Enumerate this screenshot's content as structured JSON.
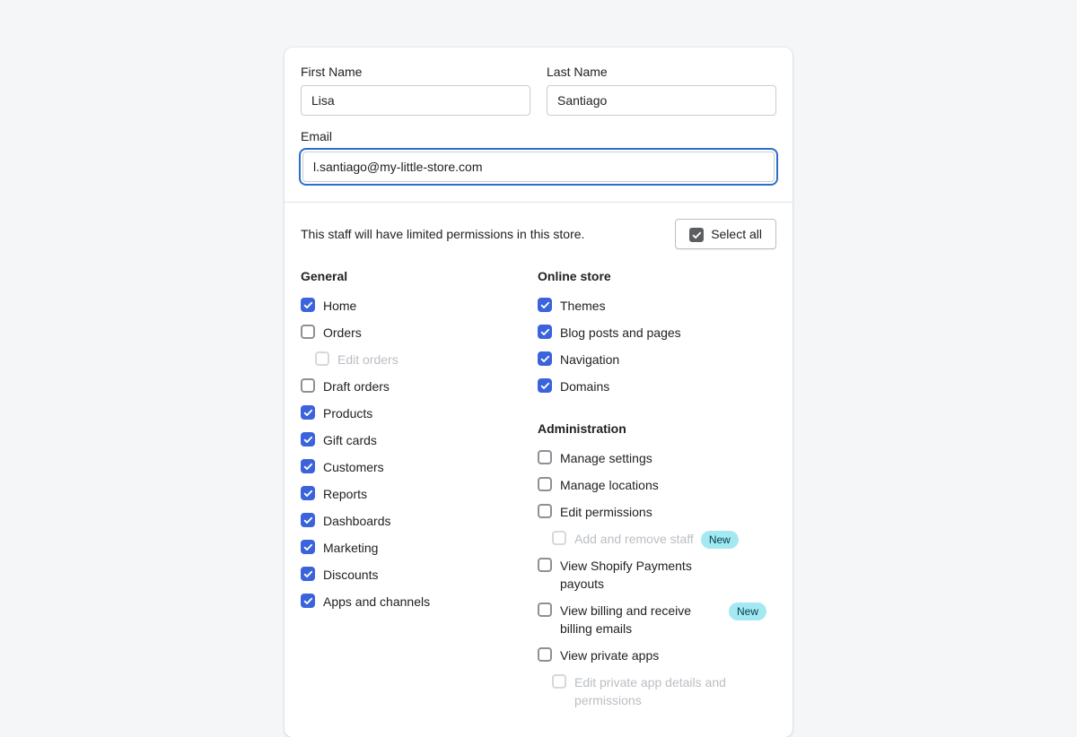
{
  "form": {
    "first_name": {
      "label": "First Name",
      "value": "Lisa",
      "placeholder": ""
    },
    "last_name": {
      "label": "Last Name",
      "value": "Santiago",
      "placeholder": ""
    },
    "email": {
      "label": "Email",
      "value": "l.santiago@my-little-store.com",
      "placeholder": ""
    }
  },
  "permissions": {
    "description": "This staff will have limited permissions in this store.",
    "select_all_label": "Select all",
    "select_all_checked": true,
    "groups": [
      {
        "title": "General",
        "column": "left",
        "items": [
          {
            "label": "Home",
            "checked": true,
            "sub": false,
            "disabled": false,
            "badge": ""
          },
          {
            "label": "Orders",
            "checked": false,
            "sub": false,
            "disabled": false,
            "badge": ""
          },
          {
            "label": "Edit orders",
            "checked": false,
            "sub": true,
            "disabled": true,
            "badge": ""
          },
          {
            "label": "Draft orders",
            "checked": false,
            "sub": false,
            "disabled": false,
            "badge": ""
          },
          {
            "label": "Products",
            "checked": true,
            "sub": false,
            "disabled": false,
            "badge": ""
          },
          {
            "label": "Gift cards",
            "checked": true,
            "sub": false,
            "disabled": false,
            "badge": ""
          },
          {
            "label": "Customers",
            "checked": true,
            "sub": false,
            "disabled": false,
            "badge": ""
          },
          {
            "label": "Reports",
            "checked": true,
            "sub": false,
            "disabled": false,
            "badge": ""
          },
          {
            "label": "Dashboards",
            "checked": true,
            "sub": false,
            "disabled": false,
            "badge": ""
          },
          {
            "label": "Marketing",
            "checked": true,
            "sub": false,
            "disabled": false,
            "badge": ""
          },
          {
            "label": "Discounts",
            "checked": true,
            "sub": false,
            "disabled": false,
            "badge": ""
          },
          {
            "label": "Apps and channels",
            "checked": true,
            "sub": false,
            "disabled": false,
            "badge": ""
          }
        ]
      },
      {
        "title": "Online store",
        "column": "right",
        "items": [
          {
            "label": "Themes",
            "checked": true,
            "sub": false,
            "disabled": false,
            "badge": ""
          },
          {
            "label": "Blog posts and pages",
            "checked": true,
            "sub": false,
            "disabled": false,
            "badge": ""
          },
          {
            "label": "Navigation",
            "checked": true,
            "sub": false,
            "disabled": false,
            "badge": ""
          },
          {
            "label": "Domains",
            "checked": true,
            "sub": false,
            "disabled": false,
            "badge": ""
          }
        ]
      },
      {
        "title": "Administration",
        "column": "right",
        "items": [
          {
            "label": "Manage settings",
            "checked": false,
            "sub": false,
            "disabled": false,
            "badge": ""
          },
          {
            "label": "Manage locations",
            "checked": false,
            "sub": false,
            "disabled": false,
            "badge": ""
          },
          {
            "label": "Edit permissions",
            "checked": false,
            "sub": false,
            "disabled": false,
            "badge": ""
          },
          {
            "label": "Add and remove staff",
            "checked": false,
            "sub": true,
            "disabled": true,
            "badge": "New"
          },
          {
            "label": "View Shopify Payments payouts",
            "checked": false,
            "sub": false,
            "disabled": false,
            "badge": ""
          },
          {
            "label": "View billing and receive billing emails",
            "checked": false,
            "sub": false,
            "disabled": false,
            "badge": "New"
          },
          {
            "label": "View private apps",
            "checked": false,
            "sub": false,
            "disabled": false,
            "badge": ""
          },
          {
            "label": "Edit private app details and permissions",
            "checked": false,
            "sub": true,
            "disabled": true,
            "badge": ""
          }
        ]
      }
    ]
  },
  "colors": {
    "accent_blue": "#3b63db",
    "focus_blue": "#2c6ecb",
    "badge_bg": "#a4e8f2",
    "badge_text": "#00404e",
    "page_bg": "#f4f6f8",
    "text": "#202223"
  }
}
